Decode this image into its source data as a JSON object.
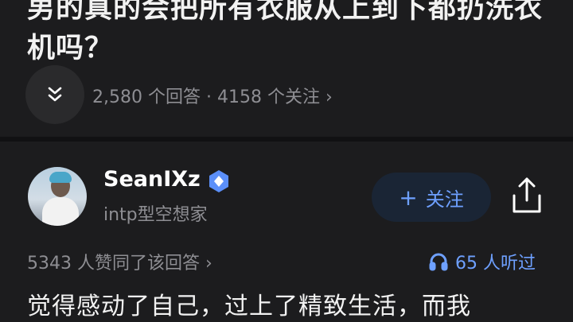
{
  "question": {
    "title": "男的真的会把所有衣服从上到下都扔洗衣机吗？",
    "answers_count": "2,580 个回答",
    "separator": "·",
    "followers_count": "4158 个关注",
    "chevron": "›"
  },
  "answer": {
    "author": {
      "name": "SeanIXz",
      "bio": "intp型空想家",
      "avatar_icon": "avatar-photo",
      "verified_icon": "verified-badge-icon"
    },
    "follow_button": {
      "plus": "+",
      "label": "关注"
    },
    "share_icon": "share-icon",
    "likes_text": "5343 人赞同了该回答",
    "likes_chevron": "›",
    "listens_text": "65 人听过",
    "text_preview": "觉得感动了自己，过上了精致生活，而我"
  },
  "colors": {
    "background": "#1c1c1e",
    "accent_blue": "#6ea0ff",
    "muted_text": "#8e8e93"
  }
}
